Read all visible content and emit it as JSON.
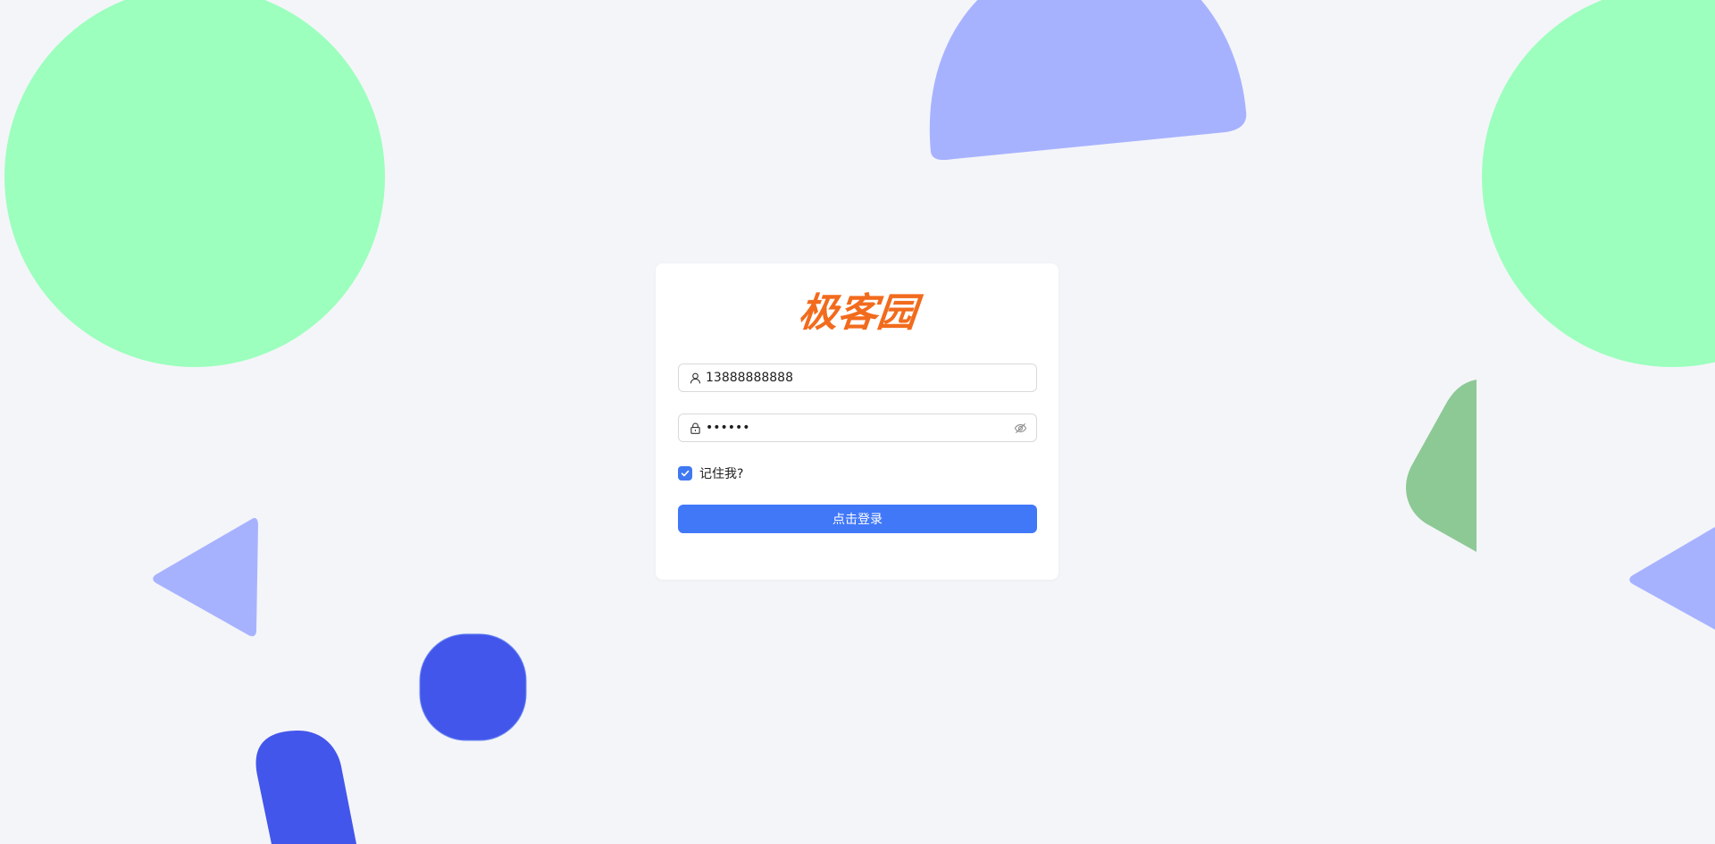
{
  "brand": {
    "logo_text": "极客园",
    "logo_color": "#f26b1d"
  },
  "form": {
    "username": {
      "value": "13888888888",
      "icon": "user-icon"
    },
    "password": {
      "value": "••••••",
      "icon": "lock-icon",
      "toggle_icon": "eye-invisible-icon"
    },
    "remember": {
      "label": "记住我?",
      "checked": true
    },
    "submit_label": "点击登录"
  },
  "colors": {
    "background": "#f4f5f9",
    "primary": "#4078f8",
    "shape_green": "#9cffbd",
    "shape_periwinkle": "#a7b2ff",
    "shape_blue": "#4356eb",
    "shape_dark_green": "#8dc995"
  }
}
